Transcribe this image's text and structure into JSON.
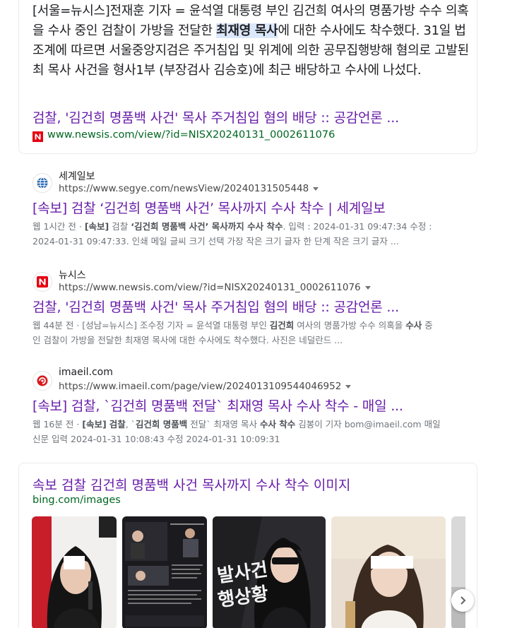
{
  "top_result": {
    "snippet_before": "[서울=뉴시스]전재훈 기자 = 윤석열 대통령 부인 김건희 여사의 명품가방 수수 의혹을 수사 중인 검찰이 가방을 전달한 ",
    "snippet_highlight": "최재영 목사",
    "snippet_after": "에 대한 수사에도 착수했다. 31일 법조계에 따르면 서울중앙지검은 주거침입 및 위계에 의한 공무집행방해 혐의로 고발된 최 목사 사건을 형사1부 (부장검사 김승호)에 최근 배당하고 수사에 나섰다.",
    "link_title": "검찰, '김건희 명품백 사건' 목사 주거침입 혐의 배당 :: 공감언론 ...",
    "url": "www.newsis.com/view/?id=NISX20240131_0002611076",
    "favicon_letter": "N"
  },
  "results": [
    {
      "site_name": "세계일보",
      "url": "https://www.segye.com/newsView/20240131505448",
      "title": "[속보] 검찰 ‘김건희 명품백 사건’ 목사까지 수사 착수 | 세계일보",
      "desc_line1_html": "웹 1시간 전 · <b>[속보]</b> 검찰 <b>‘김건희 명품백 사건’ 목사까지 수사 착수</b>. 입력 : 2024-01-31 09:47:34 수정 :",
      "desc_line2": "2024-01-31 09:47:33. 인쇄 메일 글씨 크기 선택 가장 작은 크기 글자 한 단계 작은 크기 글자 ..."
    },
    {
      "site_name": "뉴시스",
      "url": "https://www.newsis.com/view/?id=NISX20240131_0002611076",
      "title": "검찰, '김건희 명품백 사건' 목사 주거침입 혐의 배당 :: 공감언론 ...",
      "desc_line1_html": "웹 44분 전 · [성남=뉴시스] 조수정 기자 = 윤석열 대통령 부인 <b>김건희</b> 여사의 명품가방 수수 의혹을 <b>수사</b> 중",
      "desc_line2": "인 검찰이 가방을 전달한 최재영 목사에 대한 수사에도 착수했다. 사진은 네덜란드 ..."
    },
    {
      "site_name": "imaeil.com",
      "url": "https://www.imaeil.com/page/view/2024013109544046952",
      "title": "[속보] 검찰, `김건희 명품백 전달` 최재영 목사 수사 착수 - 매일 ...",
      "desc_line1_html": "웹 16분 전 · <b>[속보]</b> <b>검찰</b>, `<b>김건희 명품백</b> 전달` 최재영 목사 <b>수사 착수</b> 김봉이 기자 bom@imaeil.com 매일",
      "desc_line2": "신문 입력 2024-01-31 10:08:43 수정 2024-01-31 10:09:31"
    }
  ],
  "images": {
    "title": "속보 검찰 김건희 명품백 사건 목사까지 수사 착수 이미지",
    "source": "bing.com/images",
    "thumb_text": "발사건\n행상황"
  },
  "colors": {
    "visited_link": "#681da8",
    "green_url": "#006621",
    "highlight_bg": "#dbe8fb",
    "newsis_red": "#e60012"
  }
}
